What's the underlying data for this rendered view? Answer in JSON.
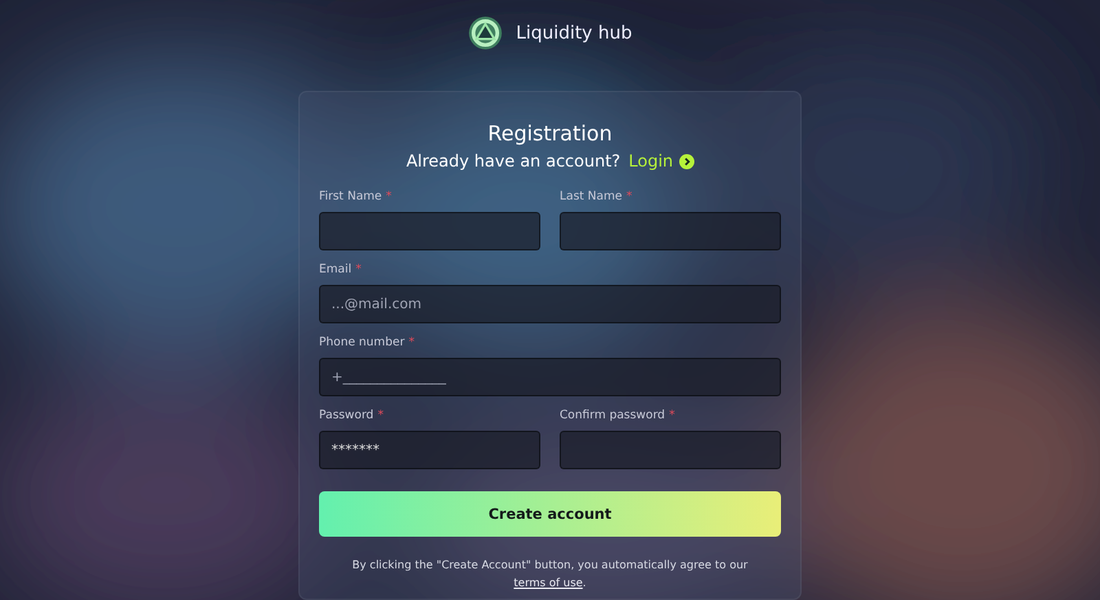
{
  "brand": {
    "name": "Liquidity hub"
  },
  "form": {
    "title": "Registration",
    "prompt": "Already have an account?",
    "login_link": "Login",
    "rows": [
      {
        "fields": [
          {
            "label": "First Name",
            "required_mark": "*"
          },
          {
            "label": "Last Name",
            "required_mark": "*"
          }
        ]
      },
      {
        "fields": [
          {
            "label": "Email",
            "required_mark": "*",
            "placeholder": "...@mail.com"
          }
        ]
      },
      {
        "fields": [
          {
            "label": "Phone number",
            "required_mark": "*",
            "placeholder": "+_______________"
          }
        ]
      },
      {
        "fields": [
          {
            "label": "Password",
            "required_mark": "*",
            "value": "*******"
          },
          {
            "label": "Confirm password",
            "required_mark": "*"
          }
        ]
      }
    ],
    "submit": "Create account",
    "notice": {
      "text": "By clicking the \"Create Account\" button, you automatically agree to our ",
      "link": "terms of use",
      "end": "."
    }
  }
}
